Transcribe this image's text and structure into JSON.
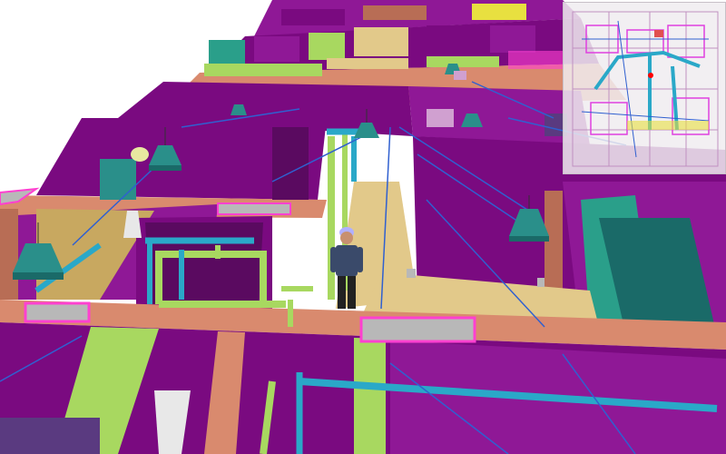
{
  "app": {
    "view": "3d-building-walkthrough"
  },
  "colors": {
    "wall_magenta": "#7a0a80",
    "wall_magenta_light": "#8f1896",
    "slab_salmon": "#d98a6e",
    "slab_salmon_dark": "#b86d55",
    "floor_tan": "#e2c98a",
    "duct_green": "#a8d860",
    "pipe_cyan": "#2aa8c8",
    "pipe_blue": "#3060d0",
    "lamp_teal": "#2a8f8a",
    "highlight_pink": "#ff40d0",
    "panel_gray": "#b8b8b8",
    "background": "#ffffff"
  },
  "icons": {
    "avatar": "person-hardhat-icon",
    "lamp": "pendant-lamp-icon",
    "minimap": "floorplan-minimap"
  },
  "minimap": {
    "marker_color": "#ff0000"
  }
}
